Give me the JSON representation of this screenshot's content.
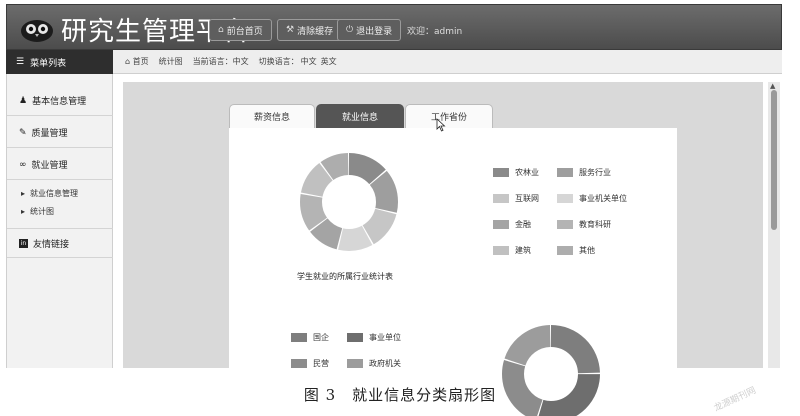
{
  "header": {
    "title": "研究生管理平台",
    "buttons": [
      {
        "label": "前台首页",
        "icon": "home-icon"
      },
      {
        "label": "清除缓存",
        "icon": "wrench-icon"
      },
      {
        "label": "退出登录",
        "icon": "power-icon"
      }
    ],
    "welcome": "欢迎：admin"
  },
  "menu_title": "菜单列表",
  "breadcrumb": {
    "home": "首页",
    "page": "统计图",
    "current_lang": "当前语言：中文",
    "switch_lang": "切换语言：",
    "lang_options": [
      "中文",
      "英文"
    ]
  },
  "sidebar": {
    "items": [
      {
        "label": "基本信息管理",
        "icon": "user-icon"
      },
      {
        "label": "质量管理",
        "icon": "edit-icon"
      },
      {
        "label": "就业管理",
        "icon": "link-icon"
      },
      {
        "label": "友情链接",
        "icon": "linkedin-icon"
      }
    ],
    "subitems": [
      "就业信息管理",
      "统计图"
    ]
  },
  "tabs": [
    {
      "label": "薪资信息",
      "active": false
    },
    {
      "label": "就业信息",
      "active": true
    },
    {
      "label": "工作省份",
      "active": false
    }
  ],
  "chart_data": [
    {
      "type": "pie",
      "title": "学生就业的所属行业统计表",
      "categories": [
        "农林业",
        "服务行业",
        "互联网",
        "事业机关单位",
        "金融",
        "教育科研",
        "建筑",
        "其他"
      ],
      "values": [
        14,
        15,
        13,
        12,
        11,
        13,
        12,
        10
      ],
      "colors": [
        "#8a8a8a",
        "#9e9e9e",
        "#c6c6c6",
        "#d6d6d6",
        "#a4a4a4",
        "#b4b4b4",
        "#c0c0c0",
        "#adadad"
      ],
      "legend": "right"
    },
    {
      "type": "pie",
      "title": "",
      "categories": [
        "国企",
        "事业单位",
        "民营",
        "政府机关"
      ],
      "values": [
        25,
        30,
        25,
        20
      ],
      "colors": [
        "#7e7e7e",
        "#6e6e6e",
        "#8c8c8c",
        "#9c9c9c"
      ],
      "legend": "left"
    }
  ],
  "caption": "图 3　就业信息分类扇形图",
  "watermark": "龙源期刊网"
}
